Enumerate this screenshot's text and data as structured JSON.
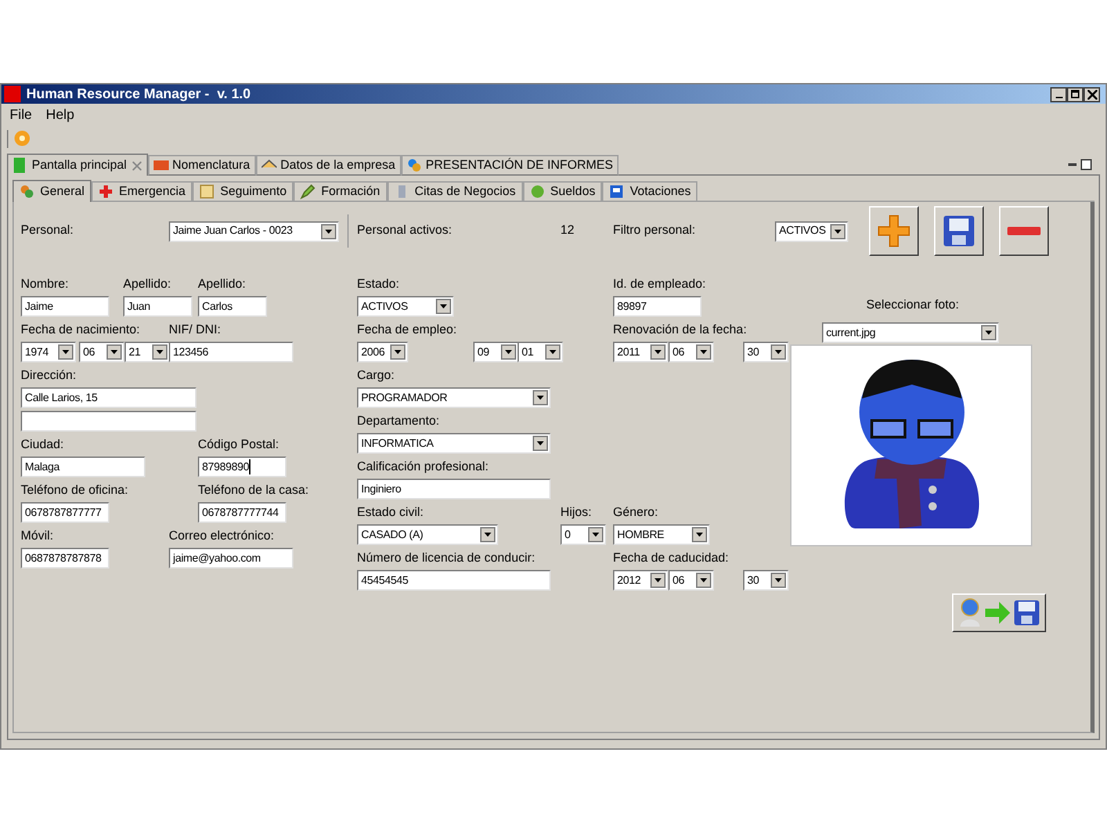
{
  "window": {
    "title": "Human Resource Manager -  v. 1.0"
  },
  "menu": [
    "File",
    "Help"
  ],
  "tabs": [
    {
      "label": "Pantalla principal",
      "selected": true,
      "closable": true
    },
    {
      "label": "Nomenclatura",
      "selected": false
    },
    {
      "label": "Datos de la empresa",
      "selected": false
    },
    {
      "label": "PRESENTACIÓN DE INFORMES",
      "selected": false
    }
  ],
  "subtabs": [
    {
      "label": "General",
      "selected": true
    },
    {
      "label": "Emergencia",
      "selected": false
    },
    {
      "label": "Seguimento",
      "selected": false
    },
    {
      "label": "Formación",
      "selected": false
    },
    {
      "label": "Citas de Negocios",
      "selected": false
    },
    {
      "label": "Sueldos",
      "selected": false
    },
    {
      "label": "Votaciones",
      "selected": false
    }
  ],
  "header": {
    "personal": {
      "label": "Personal:",
      "value": "Jaime Juan Carlos - 0023"
    },
    "active": {
      "label": "Personal activos:",
      "count": "12"
    },
    "filter": {
      "label": "Filtro personal:",
      "value": "ACTIVOS"
    }
  },
  "left_rows": [
    [
      {
        "label": "Nombre:",
        "kind": "text",
        "value": "Jaime"
      },
      {
        "label": "Apellido:",
        "kind": "text",
        "value": "Juan"
      },
      {
        "label": "Apellido:",
        "kind": "text",
        "value": "Carlos"
      }
    ],
    [
      {
        "label": "Fecha de nacimiento:",
        "kind": "date",
        "parts": [
          "1974",
          "06",
          "21"
        ]
      },
      {
        "label": "NIF/ DNI:",
        "kind": "text",
        "value": "123456"
      }
    ],
    [
      {
        "label": "Dirección:",
        "kind": "text",
        "value": "Calle Larios, 15"
      }
    ],
    [
      {
        "kind": "text"
      }
    ],
    [
      {
        "label": "Ciudad:",
        "kind": "text",
        "value": "Malaga"
      },
      {
        "label": "Código Postal:",
        "kind": "text",
        "value": "87989890",
        "focused": true
      }
    ],
    [
      {
        "label": "Teléfono de oficina:",
        "kind": "text",
        "value": "0678787877777"
      },
      {
        "label": "Teléfono de la casa:",
        "kind": "text",
        "value": "0678787777744"
      }
    ],
    [
      {
        "label": "Móvil:",
        "kind": "text",
        "value": "0687878787878"
      },
      {
        "label": "Correo electrónico:",
        "kind": "text",
        "value": "jaime@yahoo.com"
      }
    ]
  ],
  "middle_rows": [
    [
      {
        "label": "Estado:",
        "kind": "combo",
        "value": "ACTIVOS"
      },
      {
        "label": "Id. de empleado:",
        "kind": "text",
        "value": "89897"
      }
    ],
    [
      {
        "label": "Fecha de empleo:",
        "kind": "date",
        "parts": [
          "2006",
          "09",
          "01"
        ]
      },
      {
        "label": "Renovación de la fecha:",
        "kind": "date",
        "parts": [
          "2011",
          "06",
          "30"
        ]
      }
    ],
    [
      {
        "label": "Cargo:",
        "kind": "combo",
        "value": "PROGRAMADOR"
      }
    ],
    [
      {
        "label": "Departamento:",
        "kind": "combo",
        "value": "INFORMATICA"
      }
    ],
    [
      {
        "label": "Calificación profesional:",
        "kind": "text",
        "value": "Inginiero"
      }
    ],
    [
      {
        "label": "Estado civil:",
        "kind": "combo",
        "value": "CASADO (A)"
      },
      {
        "label": "Hijos:",
        "kind": "combo",
        "value": "0"
      },
      {
        "label": "Género:",
        "kind": "combo",
        "value": "HOMBRE"
      }
    ],
    [
      {
        "label": "Número de licencia de conducir:",
        "kind": "text",
        "value": "45454545"
      },
      {
        "label": "Fecha de caducidad:",
        "kind": "date",
        "parts": [
          "2012",
          "06",
          "30"
        ]
      }
    ]
  ],
  "photo": {
    "label": "Seleccionar foto:",
    "value": "current.jpg"
  }
}
